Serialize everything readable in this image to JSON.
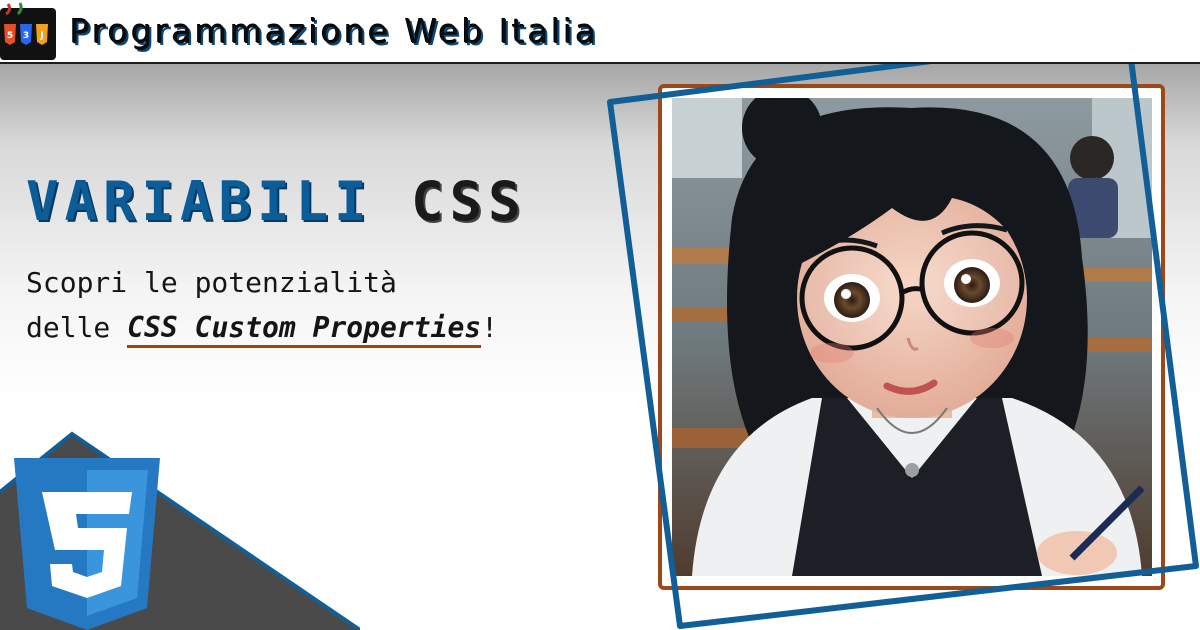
{
  "header": {
    "site_name": "Programmazione Web Italia"
  },
  "hero": {
    "title_part1": "VARIABILI",
    "title_part2": "CSS",
    "subtitle_line1": "Scopri le potenzialità",
    "subtitle_pre": "delle ",
    "subtitle_emphasis": "CSS Custom Properties",
    "subtitle_post": "!"
  },
  "icons": {
    "site_logo": "html-css-js-shields-logo",
    "css_badge": "css3-shield-icon",
    "illustration": "student-with-glasses-illustration"
  },
  "colors": {
    "brand_blue": "#0c5c97",
    "frame_brown": "#9c4818",
    "frame_blue": "#115f96",
    "dark_triangle": "#4a4a4a",
    "css_shield": "#2479c2"
  }
}
